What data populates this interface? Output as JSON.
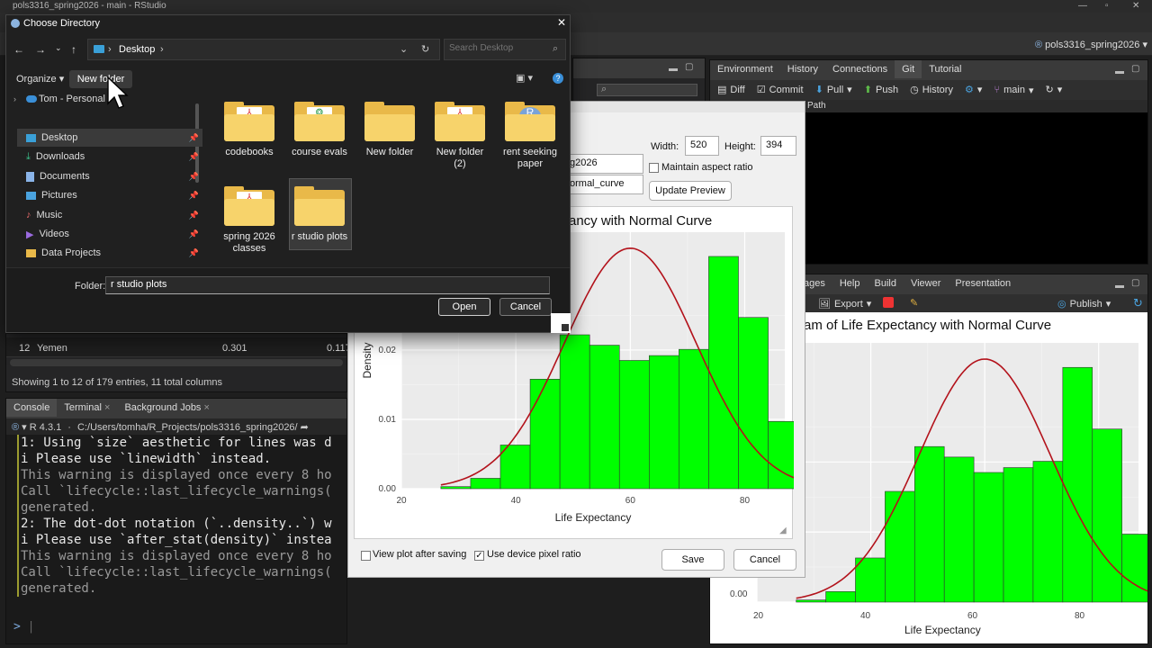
{
  "app": {
    "window_title": "pols3316_spring2026 - main - RStudio",
    "project_label": "pols3316_spring2026"
  },
  "env_pane": {
    "tabs": [
      "Environment",
      "History",
      "Connections",
      "Git",
      "Tutorial"
    ],
    "active_tab": "Git",
    "toolbar": {
      "diff": "Diff",
      "commit": "Commit",
      "pull": "Pull",
      "push": "Push",
      "history": "History",
      "branch": "main"
    },
    "path_label": "Path"
  },
  "files_pane": {
    "tabs": [
      "ages",
      "Help",
      "Build",
      "Viewer",
      "Presentation"
    ],
    "export_label": "Export",
    "publish_label": "Publish",
    "plot_title": "am of Life Expectancy with Normal Curve",
    "xlabel": "Life Expectancy",
    "x_ticks": [
      "20",
      "40",
      "60",
      "80"
    ],
    "y_tick": "0.00"
  },
  "data_viewer": {
    "row_num": "12",
    "row_name": "Yemen",
    "row_val1": "0.301",
    "row_val2": "0.117",
    "footer": "Showing 1 to 12 of 179 entries, 11 total columns"
  },
  "console": {
    "tabs": [
      "Console",
      "Terminal",
      "Background Jobs"
    ],
    "r_version": "R 4.3.1",
    "path": "C:/Users/tomha/R_Projects/pols3316_spring2026/",
    "lines": [
      {
        "text": "1: Using `size` aesthetic for lines was d",
        "dim": false
      },
      {
        "text": "i Please use `linewidth` instead.",
        "dim": false
      },
      {
        "text": "This warning is displayed once every 8 ho",
        "dim": true
      },
      {
        "text": "Call `lifecycle::last_lifecycle_warnings(",
        "dim": true
      },
      {
        "text": "generated.",
        "dim": true
      },
      {
        "text": "2: The dot-dot notation (`..density..`) w",
        "dim": false
      },
      {
        "text": "i Please use `after_stat(density)` instea",
        "dim": false
      },
      {
        "text": "This warning is displayed once every 8 ho",
        "dim": true
      },
      {
        "text": "Call `lifecycle::last_lifecycle_warnings(",
        "dim": true
      },
      {
        "text": "generated.",
        "dim": true
      }
    ],
    "prompt": ">"
  },
  "choose_dir": {
    "title": "Choose Directory",
    "breadcrumb": "Desktop",
    "search_placeholder": "Search Desktop",
    "organize": "Organize",
    "new_folder": "New folder",
    "personal": "Tom - Personal",
    "nav": [
      "Desktop",
      "Downloads",
      "Documents",
      "Pictures",
      "Music",
      "Videos",
      "Data Projects"
    ],
    "folders": [
      {
        "name": "codebooks",
        "kind": "pdf"
      },
      {
        "name": "course evals",
        "kind": "doc"
      },
      {
        "name": "New folder",
        "kind": "empty"
      },
      {
        "name": "New folder (2)",
        "kind": "pdf"
      },
      {
        "name": "rent seeking paper",
        "kind": "r"
      },
      {
        "name": "spring 2026 classes",
        "kind": "pdf"
      },
      {
        "name": "r studio plots",
        "kind": "empty",
        "selected": true
      }
    ],
    "folder_label": "Folder:",
    "folder_value": "r studio plots",
    "open": "Open",
    "cancel": "Cancel"
  },
  "save_plot": {
    "width_label": "Width:",
    "width_value": "520",
    "height_label": "Height:",
    "height_value": "394",
    "maintain": "Maintain aspect ratio",
    "update": "Update Preview",
    "dir_value": "g2026",
    "file_value": "ormal_curve",
    "view_after": "View plot after saving",
    "device_ratio": "Use device pixel ratio",
    "save": "Save",
    "cancel": "Cancel"
  },
  "chart_data": {
    "type": "bar",
    "title": "ancy with Normal Curve",
    "xlabel": "Life Expectancy",
    "ylabel": "Density",
    "xlim": [
      20,
      87
    ],
    "ylim": [
      0,
      0.037
    ],
    "x_ticks": [
      20,
      40,
      60,
      80
    ],
    "y_ticks": [
      0.0,
      0.01,
      0.02
    ],
    "y_tick_labels": [
      "0.00",
      "0.01",
      "0.02"
    ],
    "bin_width": 5.2,
    "bin_starts": [
      26.9,
      32.1,
      37.3,
      42.5,
      47.7,
      52.9,
      58.1,
      63.3,
      68.5,
      73.7,
      78.9
    ],
    "values": [
      0.0003,
      0.0015,
      0.0063,
      0.0158,
      0.0222,
      0.0207,
      0.0185,
      0.0192,
      0.0201,
      0.0335,
      0.0247,
      0.0097
    ],
    "curve": {
      "mean": 60,
      "sd": 11.5,
      "color": "#b3121b"
    },
    "bar_color": "#00ff00"
  }
}
